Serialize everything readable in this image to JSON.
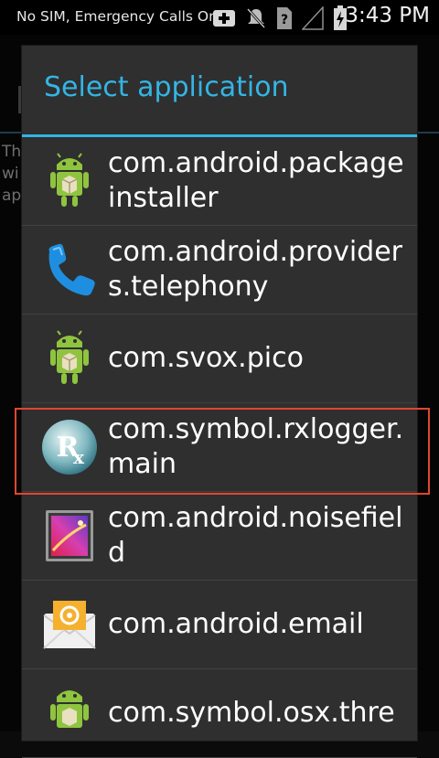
{
  "status_bar": {
    "carrier": "No SIM, Emergency Calls Only",
    "time": "3:43 PM",
    "icons": [
      "add-icon",
      "mute-icon",
      "sim-unknown-icon",
      "signal-icon",
      "battery-charging-icon"
    ]
  },
  "dialog": {
    "title": "Select application",
    "accent_color": "#33b5e5",
    "items": [
      {
        "label": "com.android.packageinstaller",
        "icon": "android-package-icon"
      },
      {
        "label": "com.android.providers.telephony",
        "icon": "phone-icon"
      },
      {
        "label": "com.svox.pico",
        "icon": "android-package-icon"
      },
      {
        "label": "com.symbol.rxlogger.main",
        "icon": "rx-logger-icon",
        "highlighted": true
      },
      {
        "label": "com.android.noisefield",
        "icon": "noisefield-icon"
      },
      {
        "label": "com.android.email",
        "icon": "email-icon"
      },
      {
        "label": "com.symbol.osx.thre",
        "icon": "android-package-icon"
      }
    ]
  },
  "highlight_color": "#e2462f"
}
